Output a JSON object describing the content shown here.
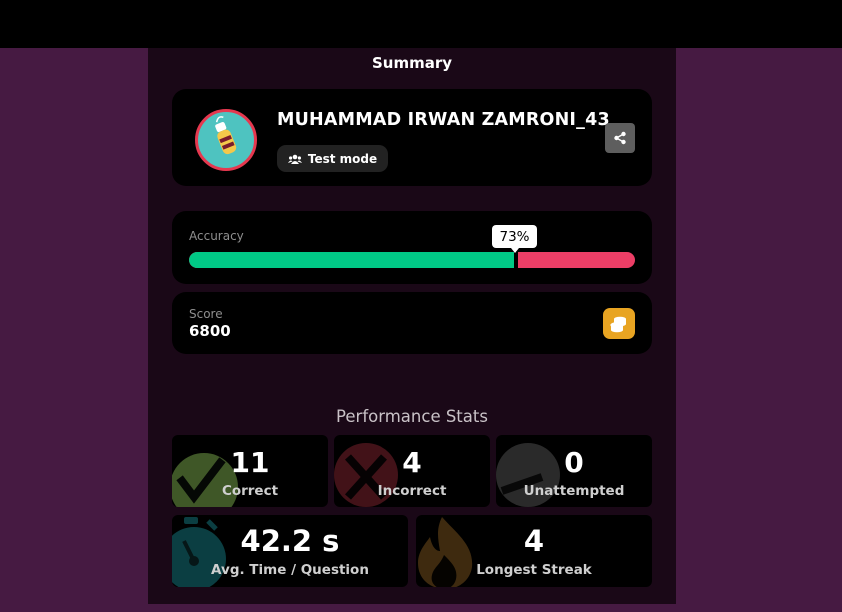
{
  "summary_title": "Summary",
  "profile": {
    "name": "MUHAMMAD IRWAN ZAMRONI_43",
    "mode_label": "Test mode"
  },
  "accuracy": {
    "label": "Accuracy",
    "percent_text": "73%",
    "value_fraction": 0.73
  },
  "score": {
    "label": "Score",
    "value": "6800"
  },
  "performance": {
    "title": "Performance Stats",
    "correct": {
      "value": "11",
      "label": "Correct"
    },
    "incorrect": {
      "value": "4",
      "label": "Incorrect"
    },
    "unattempted": {
      "value": "0",
      "label": "Unattempted"
    },
    "avg_time": {
      "value": "42.2 s",
      "label": "Avg. Time / Question"
    },
    "streak": {
      "value": "4",
      "label": "Longest Streak"
    }
  },
  "colors": {
    "background": "#461a42",
    "panel": "#1a0817",
    "correct": "#00c986",
    "incorrect": "#ec3e66",
    "coin": "#e8a422"
  }
}
